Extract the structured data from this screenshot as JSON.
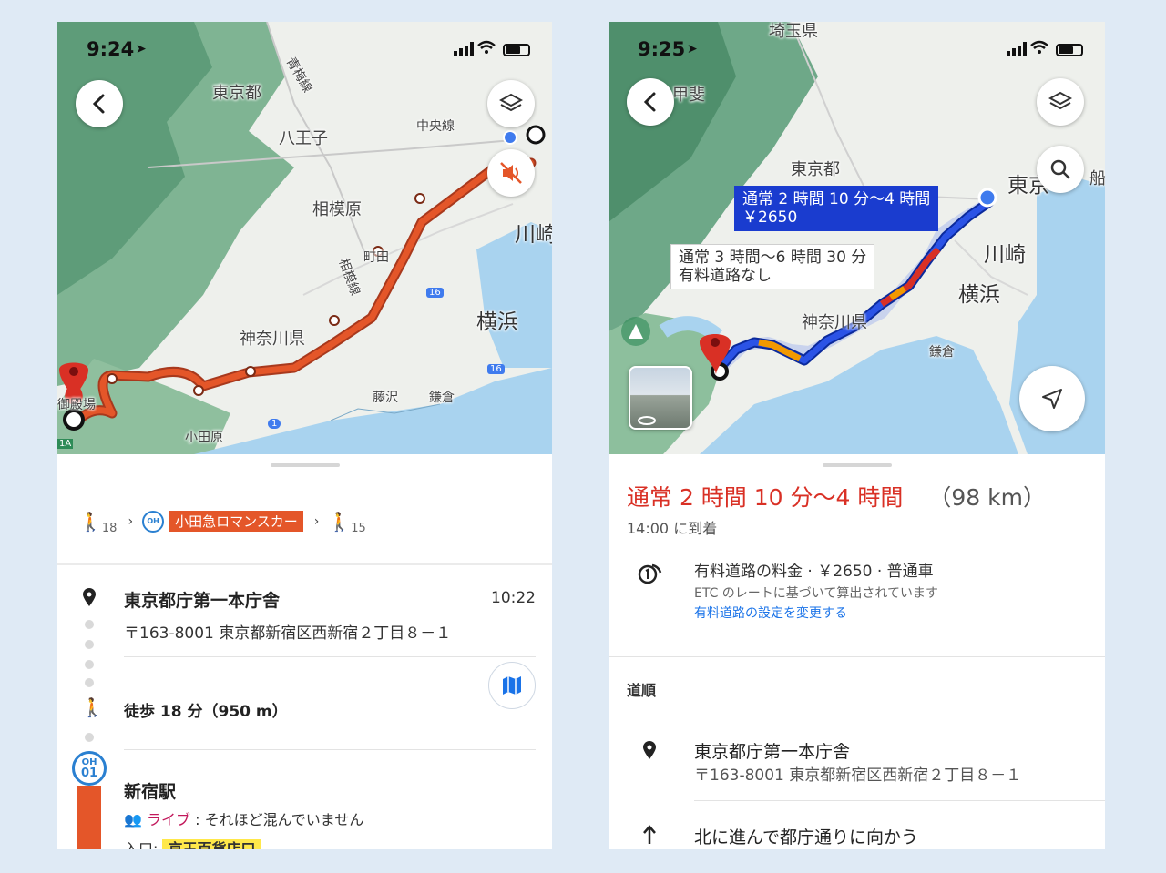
{
  "left": {
    "status": {
      "time": "9:24",
      "location_icon": "location-arrow-icon"
    },
    "map": {
      "labels": [
        "東京都",
        "青梅線",
        "八王子",
        "中央線",
        "相模原",
        "相模線",
        "町田",
        "川崎",
        "神奈川県",
        "横浜",
        "藤沢",
        "鎌倉",
        "小田原",
        "御殿場",
        "16",
        "16",
        "1",
        "1A"
      ],
      "route_color": "#e45629"
    },
    "summary": {
      "walk_before": "18",
      "line_badge": "OH",
      "line_name": "小田急ロマンスカー",
      "walk_after": "15"
    },
    "origin": {
      "name": "東京都庁第一本庁舎",
      "time": "10:22",
      "address": "〒163-8001 東京都新宿区西新宿２丁目８－１"
    },
    "walk": {
      "text": "徒歩 18 分（950 m）"
    },
    "station": {
      "badge_line1": "OH",
      "badge_line2": "01",
      "name": "新宿駅",
      "live_label": "ライブ",
      "live_text": ": それほど混んでいません",
      "entrance_label": "入口: ",
      "entrance_name": "京王百貨店口"
    }
  },
  "right": {
    "status": {
      "time": "9:25",
      "location_icon": "location-arrow-icon"
    },
    "map": {
      "labels": [
        "埼玉県",
        "甲斐",
        "東京都",
        "東京",
        "川崎",
        "横浜",
        "神奈川県",
        "鎌倉",
        "船"
      ],
      "selected_route": {
        "line1": "通常 2 時間 10 分〜4 時間",
        "line2": "￥2650"
      },
      "alt_route": {
        "line1": "通常 3 時間〜6 時間 30 分",
        "line2": "有料道路なし"
      },
      "route_color": "#1a3ccf"
    },
    "summary": {
      "duration": "通常 2 時間 10 分〜4 時間",
      "distance": "（98 km）",
      "arrival": "14:00 に到着"
    },
    "toll": {
      "title": "有料道路の料金 · ￥2650 · 普通車",
      "note": "ETC のレートに基づいて算出されています",
      "link": "有料道路の設定を変更する"
    },
    "directions": {
      "heading": "道順",
      "origin_name": "東京都庁第一本庁舎",
      "origin_address": "〒163-8001 東京都新宿区西新宿２丁目８－１",
      "first_step": "北に進んで都庁通りに向かう"
    }
  }
}
